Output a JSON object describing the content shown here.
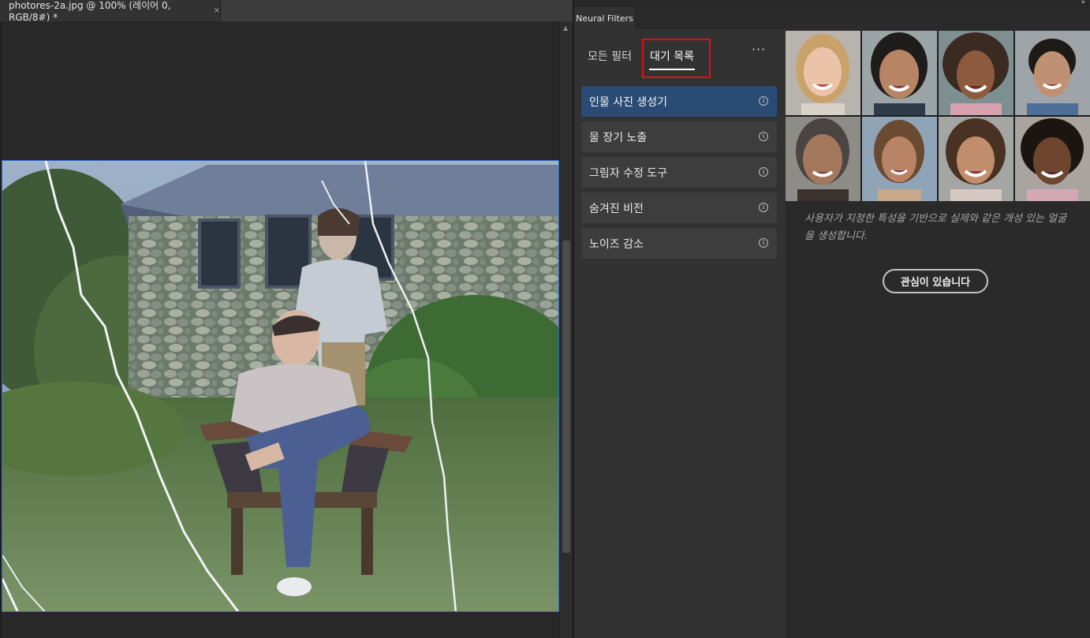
{
  "document": {
    "tab_title": "photores-2a.jpg @ 100% (레이어 0, RGB/8#) *",
    "close_glyph": "×"
  },
  "panel": {
    "tab_label": "Neural Filters",
    "collapse_glyph": "››",
    "subtabs": {
      "all_filters": "모든 필터",
      "waitlist": "대기 목록",
      "more": "···"
    },
    "filters": [
      {
        "label": "인물 사진 생성기",
        "selected": true
      },
      {
        "label": "물 장기 노출",
        "selected": false
      },
      {
        "label": "그림자 수정 도구",
        "selected": false
      },
      {
        "label": "숨겨진 비전",
        "selected": false
      },
      {
        "label": "노이즈 감소",
        "selected": false
      }
    ],
    "info_glyph": "i",
    "description": "사용자가 지정한 특성을 기반으로 실제와 같은 개성 있는 얼굴을 생성합니다.",
    "interest_button": "관심이 있습니다"
  },
  "colors": {
    "selection_blue": "#2a4b73",
    "highlight_red": "#e0101a",
    "canvas_border": "#2f6fd3"
  }
}
